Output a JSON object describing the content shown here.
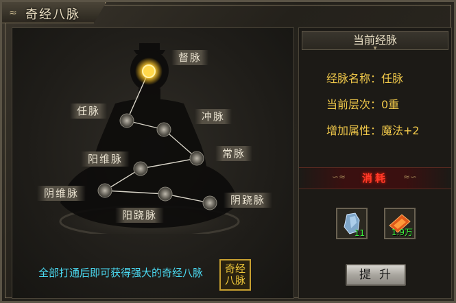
{
  "window": {
    "title": "奇经八脉"
  },
  "meridians": {
    "du": "督脉",
    "ren": "任脉",
    "chong": "冲脉",
    "chang": "常脉",
    "yangwei": "阳维脉",
    "yinwei": "阴维脉",
    "yangqiao": "阳跷脉",
    "yinqiao": "阴跷脉"
  },
  "footer": {
    "hint": "全部打通后即可获得强大的奇经八脉",
    "seal": "奇经八脉"
  },
  "current": {
    "header": "当前经脉",
    "name_row": "经脉名称：任脉",
    "level_row": "当前层次：0重",
    "bonus_row": "增加属性：魔法+2"
  },
  "consume": {
    "label": "消耗",
    "items": [
      {
        "icon": "crystal-stone-icon",
        "count": "11"
      },
      {
        "icon": "scroll-icon",
        "count": "1.9万"
      }
    ]
  },
  "actions": {
    "upgrade": "提升"
  },
  "colors": {
    "hint_text": "#4ad8f0",
    "attr_text": "#f0c84a",
    "consume_text": "#ff3a2a",
    "count_text": "#3cf03c"
  }
}
